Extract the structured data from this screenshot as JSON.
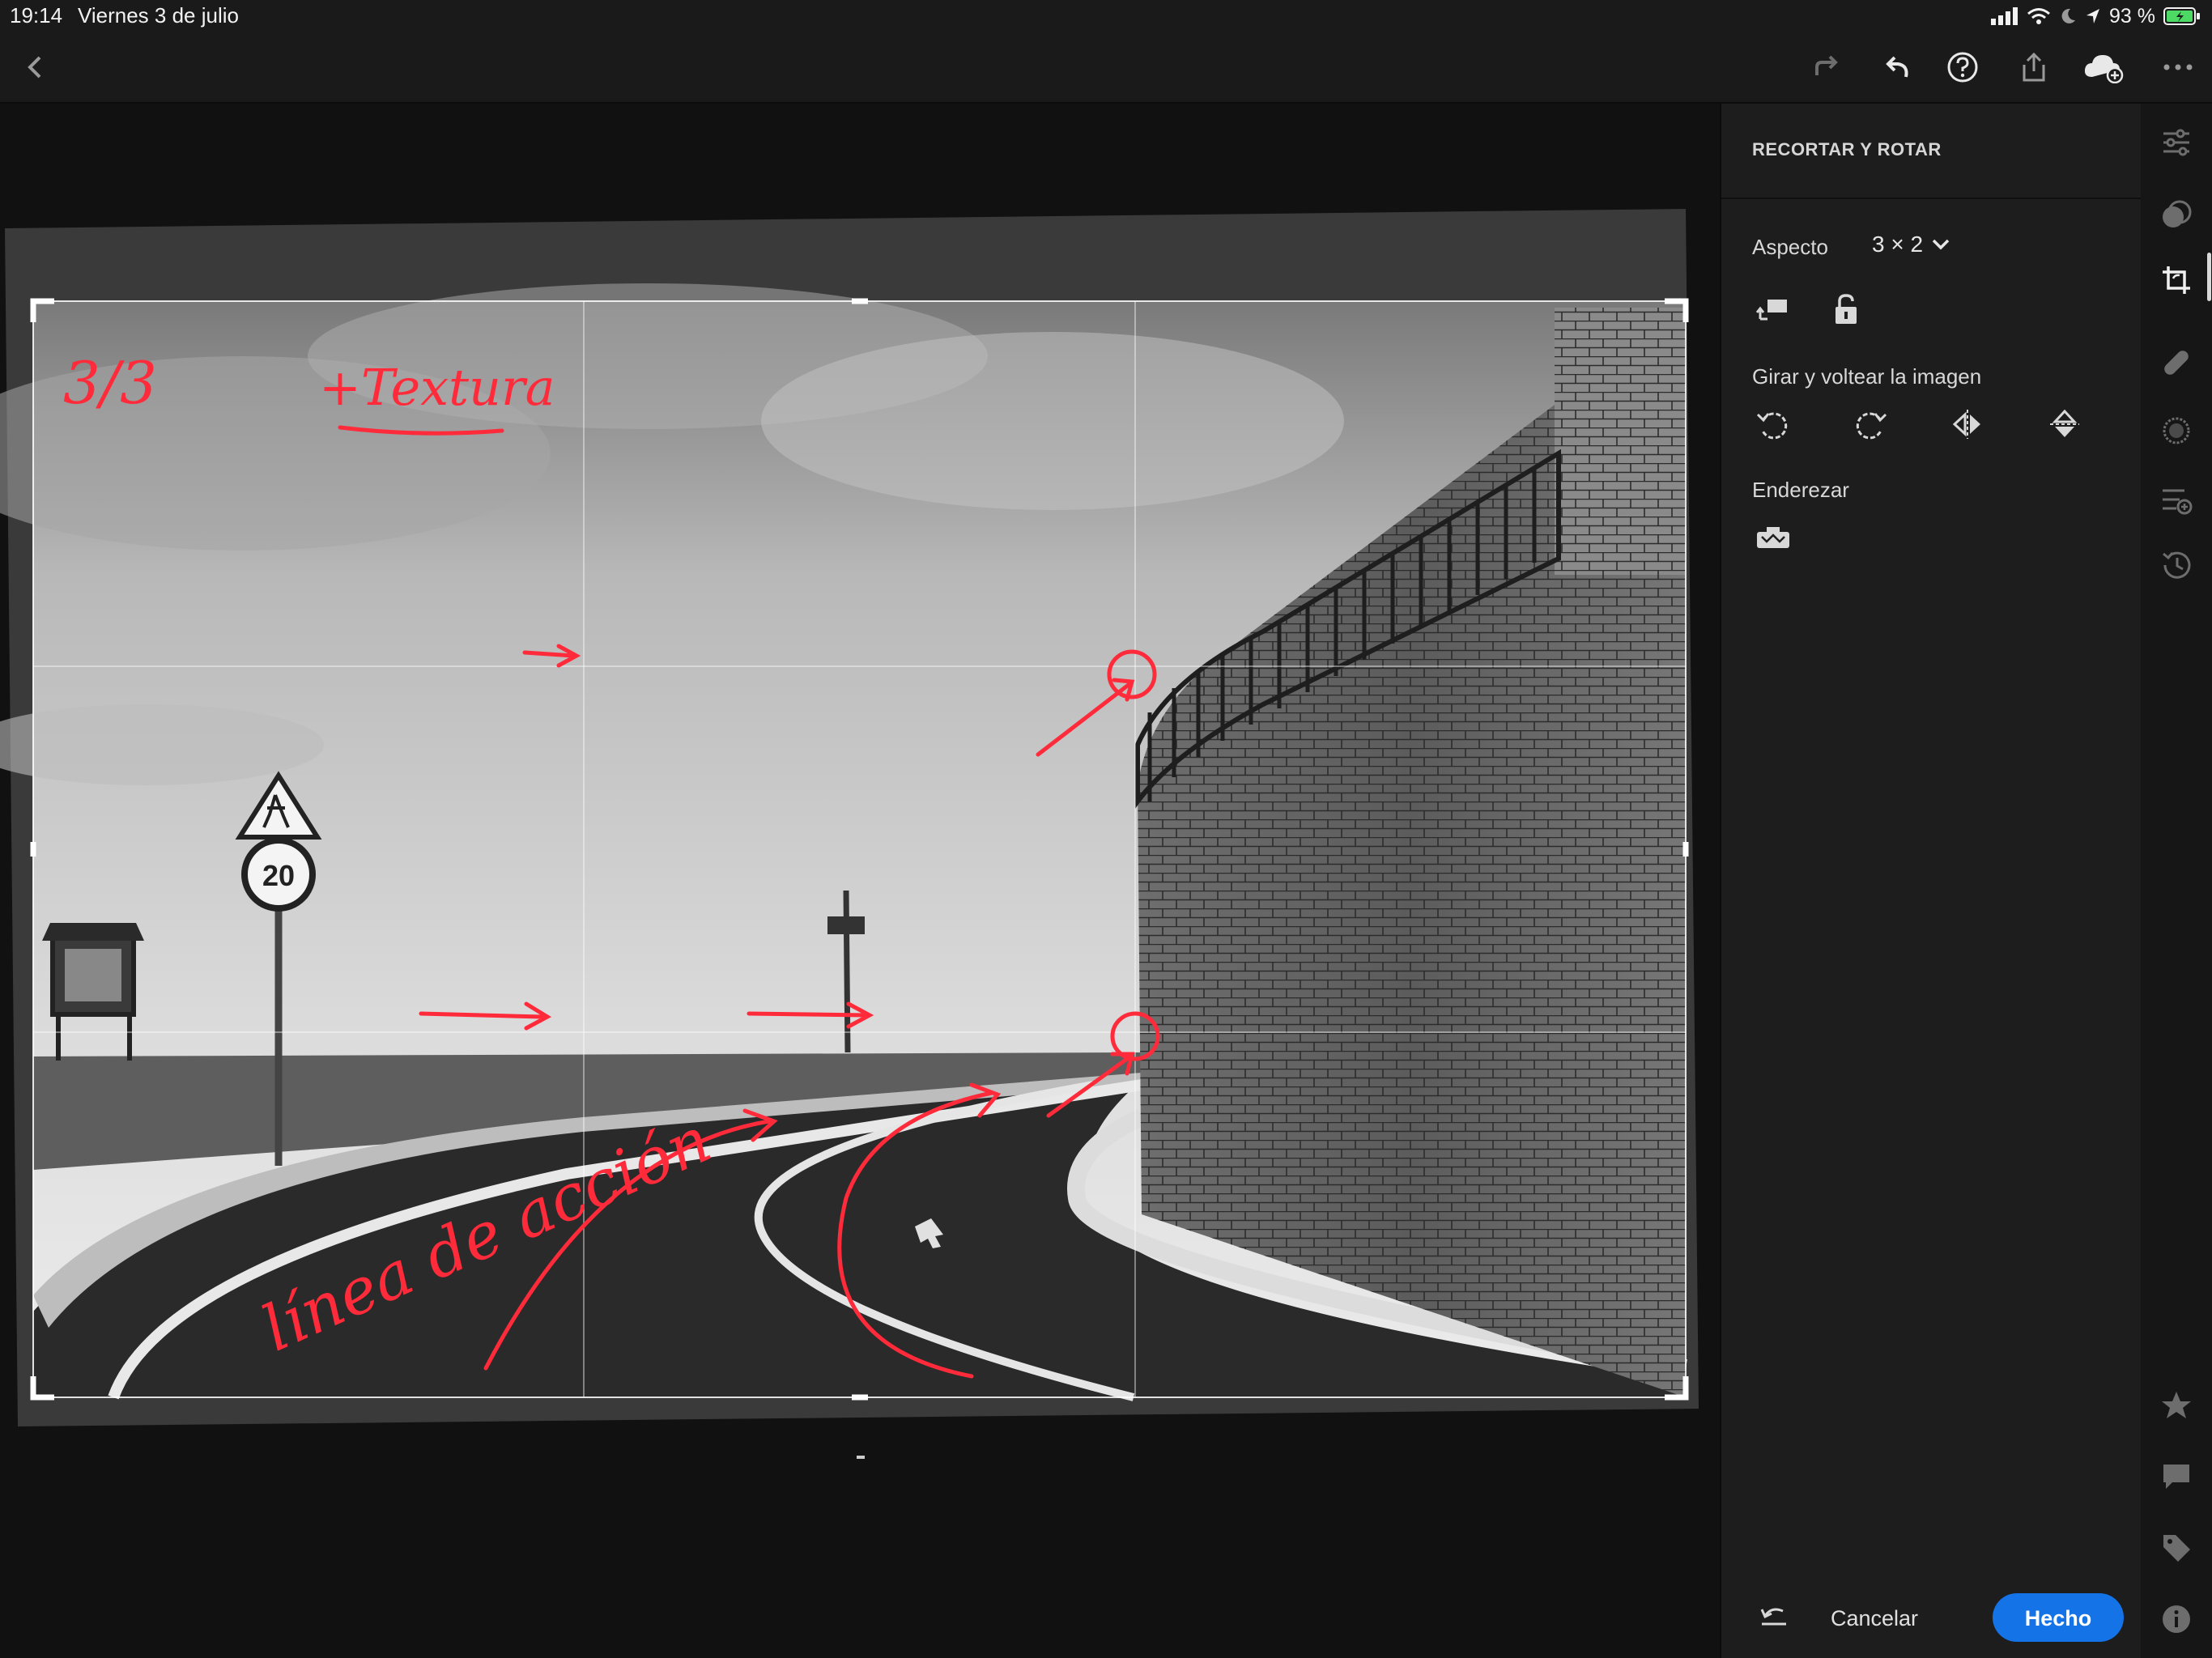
{
  "status_bar": {
    "time": "19:14",
    "date": "Viernes 3 de julio",
    "battery": "93 %"
  },
  "toolbar": {
    "icons": [
      "back-icon",
      "redo-icon",
      "undo-icon",
      "help-icon",
      "share-icon",
      "cloud-sync-icon",
      "more-icon"
    ]
  },
  "photo": {
    "sign_speed": "20",
    "annotations": {
      "corner": "3/3",
      "texture": "+Textura",
      "action_line": "línea de acción"
    },
    "colors": {
      "annotation": "#ff2a3a"
    }
  },
  "panel": {
    "title": "RECORTAR Y ROTAR",
    "aspect_label": "Aspecto",
    "aspect_value": "3 × 2",
    "rotate_label": "Girar y voltear la imagen",
    "straighten_label": "Enderezar",
    "cancel_label": "Cancelar",
    "done_label": "Hecho",
    "colors": {
      "accent": "#1473e6"
    }
  },
  "rail": {
    "icons": [
      "edit-sliders-icon",
      "presets-icon",
      "crop-icon",
      "healing-icon",
      "masking-icon",
      "versions-icon",
      "history-icon",
      "star-icon",
      "comment-icon",
      "tag-icon",
      "info-icon"
    ],
    "active": "crop-icon"
  }
}
